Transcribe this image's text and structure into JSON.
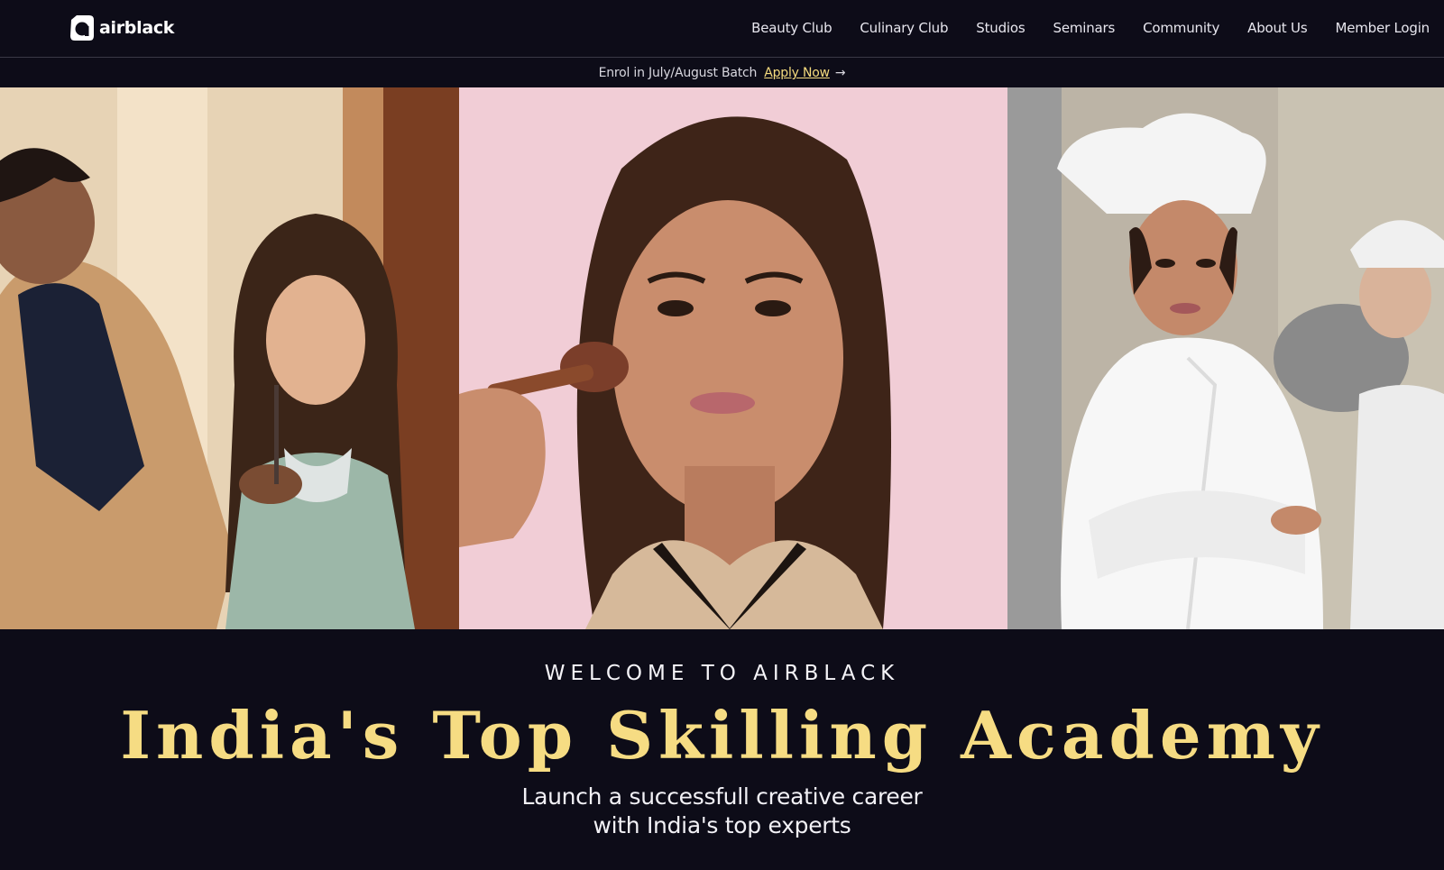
{
  "brand": {
    "name": "airblack",
    "logo_icon": "airblack-logo-icon"
  },
  "nav": {
    "items": [
      {
        "label": "Beauty Club"
      },
      {
        "label": "Culinary Club"
      },
      {
        "label": "Studios"
      },
      {
        "label": "Seminars"
      },
      {
        "label": "Community"
      },
      {
        "label": "About Us"
      },
      {
        "label": "Member Login"
      }
    ]
  },
  "announcement": {
    "text": "Enrol in July/August Batch",
    "cta": "Apply Now",
    "cta_icon": "arrow-right-icon"
  },
  "hero": {
    "images": [
      {
        "name": "makeup-artist-bridal-photo"
      },
      {
        "name": "woman-makeup-brush-photo"
      },
      {
        "name": "chef-portrait-photo"
      }
    ]
  },
  "welcome": {
    "eyebrow": "WELCOME TO AIRBLACK",
    "headline": "India's Top Skilling Academy",
    "subline_1": "Launch a successfull creative career",
    "subline_2": "with India's top experts"
  },
  "colors": {
    "background": "#0d0c18",
    "accent_gold": "#f6dc83",
    "link_gold": "#f5db7e"
  }
}
